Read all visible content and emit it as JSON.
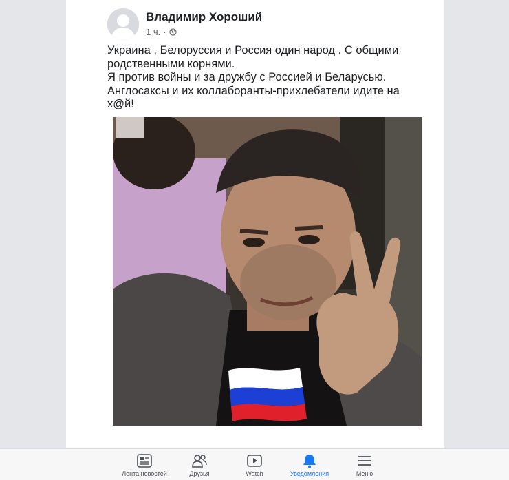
{
  "post": {
    "author": "Владимир Хороший",
    "time": "1 ч.",
    "separator": "·",
    "lines": [
      "Украина , Белоруссия и Россия один народ . С общими",
      "родственными  корнями.",
      "Я против войны и за дружбу с Россией и Беларусью.",
      "Англосаксы и их коллаборанты-прихлебатели  идите на",
      "х@й!"
    ],
    "icons": {
      "audience": "globe-icon",
      "avatar": "default-avatar-icon"
    }
  },
  "tabbar": {
    "tabs": [
      {
        "label": "Лента новостей",
        "icon": "news-feed-icon"
      },
      {
        "label": "Друзья",
        "icon": "friends-icon"
      },
      {
        "label": "Watch",
        "icon": "watch-icon"
      },
      {
        "label": "Уведомления",
        "icon": "bell-icon"
      },
      {
        "label": "Меню",
        "icon": "menu-icon"
      }
    ],
    "active_index": 3,
    "accent_color": "#1877f2"
  },
  "colors": {
    "flag_white": "#ffffff",
    "flag_blue": "#1c3fd6",
    "flag_red": "#e0202a"
  }
}
